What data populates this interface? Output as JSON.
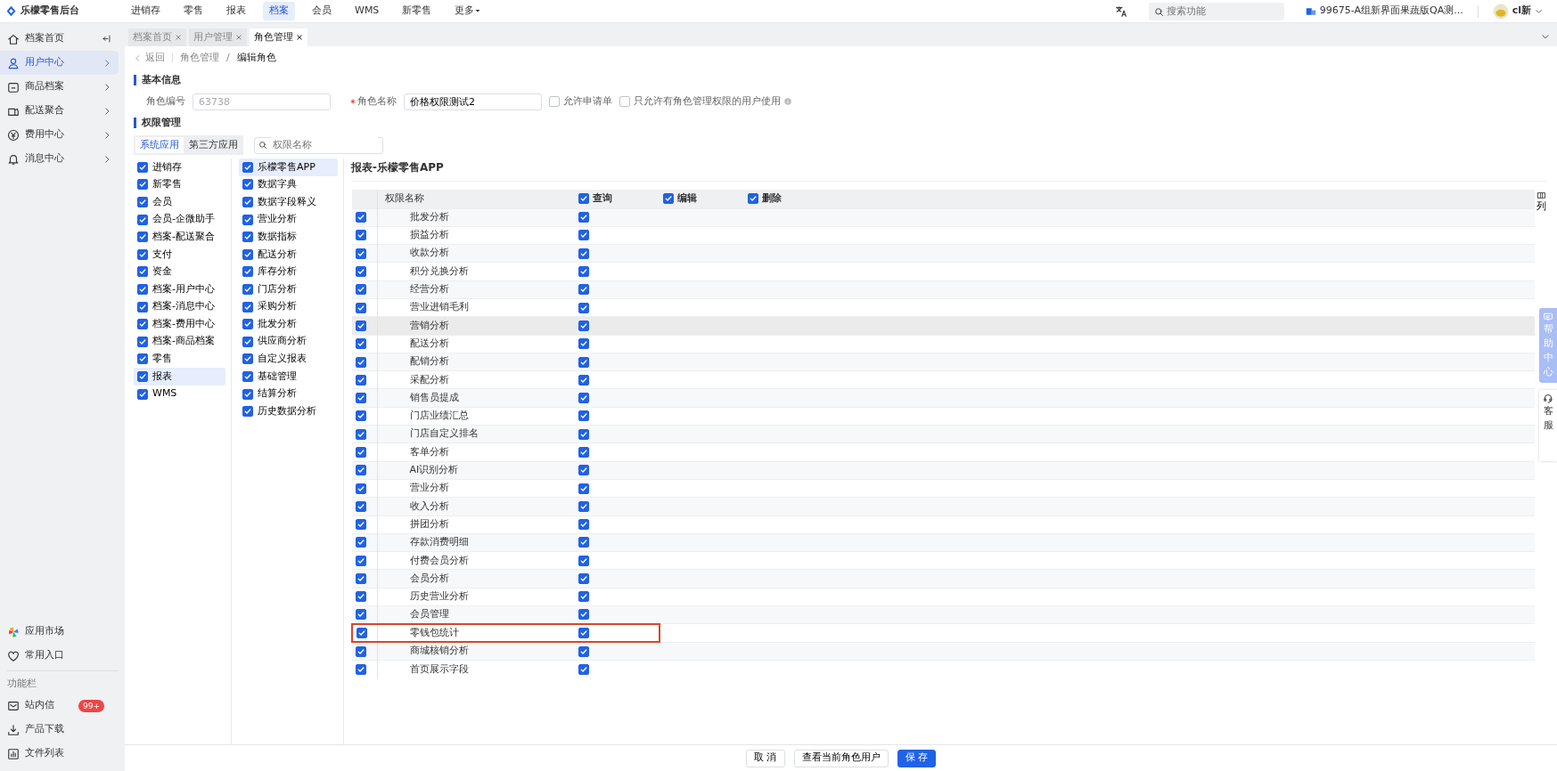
{
  "app": {
    "name": "乐檬零售后台"
  },
  "top_nav": [
    {
      "label": "进销存",
      "selected": false,
      "kind": "link"
    },
    {
      "label": "零售",
      "selected": false,
      "kind": "link"
    },
    {
      "label": "报表",
      "selected": false,
      "kind": "link"
    },
    {
      "label": "档案",
      "selected": true,
      "kind": "link"
    },
    {
      "label": "会员",
      "selected": false,
      "kind": "link"
    },
    {
      "label": "WMS",
      "selected": false,
      "kind": "link"
    },
    {
      "label": "新零售",
      "selected": false,
      "kind": "link"
    },
    {
      "label": "更多",
      "selected": false,
      "kind": "dropdown"
    }
  ],
  "search": {
    "placeholder": "搜索功能"
  },
  "store": "99675-A组新界面果蔬版QA测...",
  "user": "cl新",
  "sidebar": {
    "items": [
      {
        "label": "档案首页",
        "selected": false,
        "kind": "home"
      },
      {
        "label": "用户中心",
        "selected": true,
        "kind": "user"
      },
      {
        "label": "商品档案",
        "selected": false,
        "kind": "box"
      },
      {
        "label": "配送聚合",
        "selected": false,
        "kind": "truck"
      },
      {
        "label": "费用中心",
        "selected": false,
        "kind": "yen"
      },
      {
        "label": "消息中心",
        "selected": false,
        "kind": "bell"
      }
    ],
    "shortcuts": [
      {
        "label": "应用市场",
        "kind": "apps"
      },
      {
        "label": "常用入口",
        "kind": "heart"
      }
    ],
    "section_label": "功能栏",
    "tools": [
      {
        "label": "站内信",
        "kind": "mail",
        "badge": "99+"
      },
      {
        "label": "产品下载",
        "kind": "download"
      },
      {
        "label": "文件列表",
        "kind": "chart"
      }
    ]
  },
  "page_tabs": [
    {
      "label": "档案首页",
      "selected": false
    },
    {
      "label": "用户管理",
      "selected": false
    },
    {
      "label": "角色管理",
      "selected": true
    }
  ],
  "breadcrumb": {
    "back": "返回",
    "items": [
      "角色管理",
      "编辑角色"
    ],
    "separator": "/"
  },
  "basic_info": {
    "title": "基本信息",
    "fields": [
      {
        "label": "角色编号",
        "value": "63738",
        "required": false,
        "disabled": true
      },
      {
        "label": "角色名称",
        "value": "价格权限测试2",
        "required": true,
        "disabled": false
      }
    ],
    "options": [
      {
        "label": "允许申请单",
        "checked": false,
        "info": false
      },
      {
        "label": "只允许有角色管理权限的用户使用",
        "checked": false,
        "info": true
      }
    ]
  },
  "permissions": {
    "title": "权限管理",
    "app_tabs": [
      {
        "label": "系统应用",
        "selected": true
      },
      {
        "label": "第三方应用",
        "selected": false
      }
    ],
    "search": {
      "placeholder": "权限名称"
    },
    "modules": [
      {
        "label": "进销存",
        "checked": true,
        "selected": false
      },
      {
        "label": "新零售",
        "checked": true,
        "selected": false
      },
      {
        "label": "会员",
        "checked": true,
        "selected": false
      },
      {
        "label": "会员-企微助手",
        "checked": true,
        "selected": false
      },
      {
        "label": "档案-配送聚合",
        "checked": true,
        "selected": false
      },
      {
        "label": "支付",
        "checked": true,
        "selected": false
      },
      {
        "label": "资金",
        "checked": true,
        "selected": false
      },
      {
        "label": "档案-用户中心",
        "checked": true,
        "selected": false
      },
      {
        "label": "档案-消息中心",
        "checked": true,
        "selected": false
      },
      {
        "label": "档案-费用中心",
        "checked": true,
        "selected": false
      },
      {
        "label": "档案-商品档案",
        "checked": true,
        "selected": false
      },
      {
        "label": "零售",
        "checked": true,
        "selected": false
      },
      {
        "label": "报表",
        "checked": true,
        "selected": true
      },
      {
        "label": "WMS",
        "checked": true,
        "selected": false
      }
    ],
    "submodules": [
      {
        "label": "乐檬零售APP",
        "checked": true,
        "selected": true
      },
      {
        "label": "数据字典",
        "checked": true,
        "selected": false
      },
      {
        "label": "数据字段释义",
        "checked": true,
        "selected": false
      },
      {
        "label": "营业分析",
        "checked": true,
        "selected": false
      },
      {
        "label": "数据指标",
        "checked": true,
        "selected": false
      },
      {
        "label": "配送分析",
        "checked": true,
        "selected": false
      },
      {
        "label": "库存分析",
        "checked": true,
        "selected": false
      },
      {
        "label": "门店分析",
        "checked": true,
        "selected": false
      },
      {
        "label": "采购分析",
        "checked": true,
        "selected": false
      },
      {
        "label": "批发分析",
        "checked": true,
        "selected": false
      },
      {
        "label": "供应商分析",
        "checked": true,
        "selected": false
      },
      {
        "label": "自定义报表",
        "checked": true,
        "selected": false
      },
      {
        "label": "基础管理",
        "checked": true,
        "selected": false
      },
      {
        "label": "结算分析",
        "checked": true,
        "selected": false
      },
      {
        "label": "历史数据分析",
        "checked": true,
        "selected": false
      }
    ],
    "panel_title": "报表-乐檬零售APP",
    "columns": [
      {
        "label": "权限名称",
        "kind": "name"
      },
      {
        "label": "查询",
        "kind": "check",
        "checked": true
      },
      {
        "label": "编辑",
        "kind": "check",
        "checked": true
      },
      {
        "label": "删除",
        "kind": "check",
        "checked": true
      }
    ],
    "column_setting": "列",
    "rows": [
      {
        "name": "批发分析",
        "checked": true,
        "query": true,
        "hovered": false,
        "highlighted": false
      },
      {
        "name": "损益分析",
        "checked": true,
        "query": true,
        "hovered": false,
        "highlighted": false
      },
      {
        "name": "收款分析",
        "checked": true,
        "query": true,
        "hovered": false,
        "highlighted": false
      },
      {
        "name": "积分兑换分析",
        "checked": true,
        "query": true,
        "hovered": false,
        "highlighted": false
      },
      {
        "name": "经营分析",
        "checked": true,
        "query": true,
        "hovered": false,
        "highlighted": false
      },
      {
        "name": "营业进销毛利",
        "checked": true,
        "query": true,
        "hovered": false,
        "highlighted": false
      },
      {
        "name": "营销分析",
        "checked": true,
        "query": true,
        "hovered": true,
        "highlighted": false
      },
      {
        "name": "配送分析",
        "checked": true,
        "query": true,
        "hovered": false,
        "highlighted": false
      },
      {
        "name": "配销分析",
        "checked": true,
        "query": true,
        "hovered": false,
        "highlighted": false
      },
      {
        "name": "采配分析",
        "checked": true,
        "query": true,
        "hovered": false,
        "highlighted": false
      },
      {
        "name": "销售员提成",
        "checked": true,
        "query": true,
        "hovered": false,
        "highlighted": false
      },
      {
        "name": "门店业绩汇总",
        "checked": true,
        "query": true,
        "hovered": false,
        "highlighted": false
      },
      {
        "name": "门店自定义排名",
        "checked": true,
        "query": true,
        "hovered": false,
        "highlighted": false
      },
      {
        "name": "客单分析",
        "checked": true,
        "query": true,
        "hovered": false,
        "highlighted": false
      },
      {
        "name": "AI识别分析",
        "checked": true,
        "query": true,
        "hovered": false,
        "highlighted": false
      },
      {
        "name": "营业分析",
        "checked": true,
        "query": true,
        "hovered": false,
        "highlighted": false
      },
      {
        "name": "收入分析",
        "checked": true,
        "query": true,
        "hovered": false,
        "highlighted": false
      },
      {
        "name": "拼团分析",
        "checked": true,
        "query": true,
        "hovered": false,
        "highlighted": false
      },
      {
        "name": "存款消费明细",
        "checked": true,
        "query": true,
        "hovered": false,
        "highlighted": false
      },
      {
        "name": "付费会员分析",
        "checked": true,
        "query": true,
        "hovered": false,
        "highlighted": false
      },
      {
        "name": "会员分析",
        "checked": true,
        "query": true,
        "hovered": false,
        "highlighted": false
      },
      {
        "name": "历史营业分析",
        "checked": true,
        "query": true,
        "hovered": false,
        "highlighted": false
      },
      {
        "name": "会员管理",
        "checked": true,
        "query": true,
        "hovered": false,
        "highlighted": false
      },
      {
        "name": "零钱包统计",
        "checked": true,
        "query": true,
        "hovered": false,
        "highlighted": true
      },
      {
        "name": "商城核销分析",
        "checked": true,
        "query": true,
        "hovered": false,
        "highlighted": false
      },
      {
        "name": "首页展示字段",
        "checked": true,
        "query": true,
        "hovered": false,
        "highlighted": false
      }
    ]
  },
  "footer_buttons": [
    {
      "label": "取 消",
      "kind": "default"
    },
    {
      "label": "查看当前角色用户",
      "kind": "default"
    },
    {
      "label": "保 存",
      "kind": "primary"
    }
  ],
  "float_tabs": [
    {
      "label": "帮助中心",
      "kind": "help"
    },
    {
      "label": "客服",
      "kind": "service"
    }
  ]
}
